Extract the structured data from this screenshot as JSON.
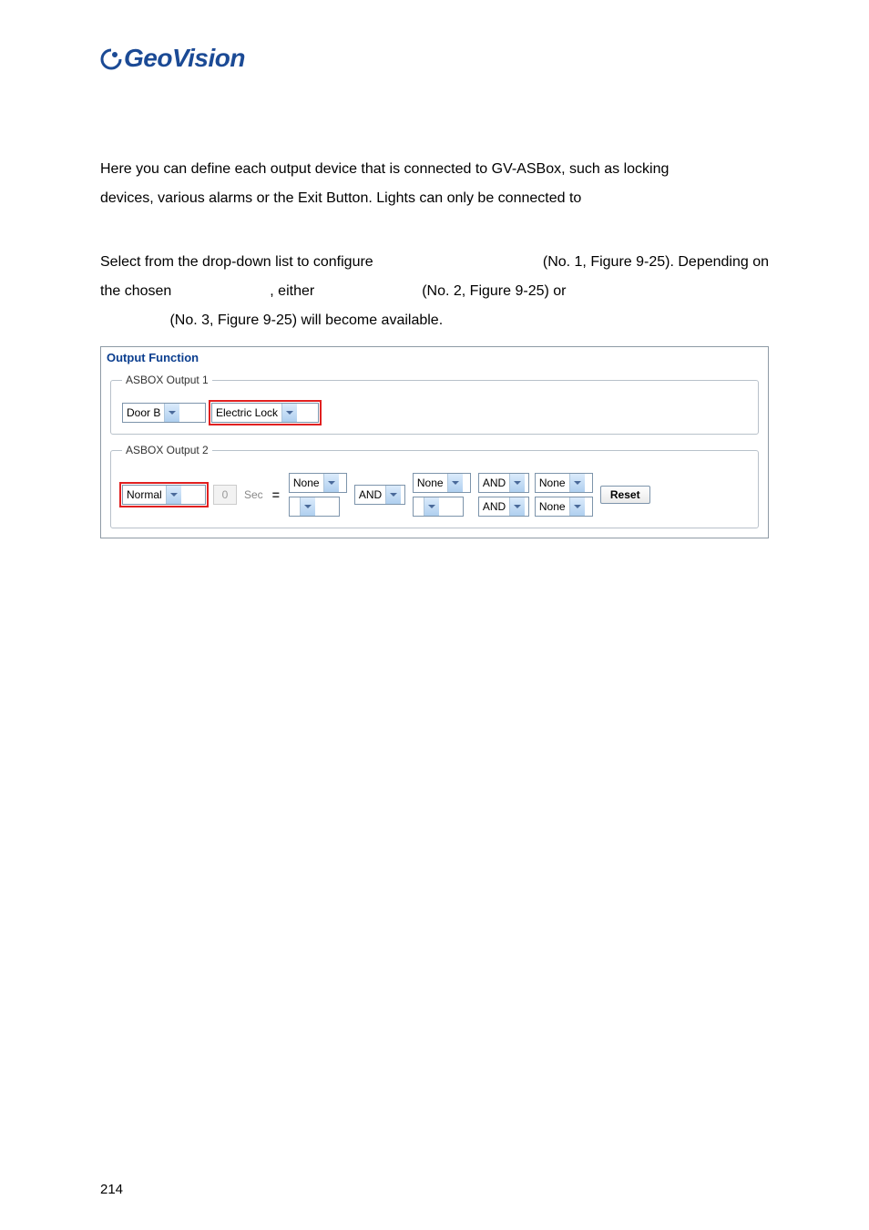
{
  "brand": "GeoVision",
  "paragraph1_a": "Here you can define each output device that is connected to GV-ASBox, such as locking",
  "paragraph1_b": "devices, various alarms or the Exit Button. Lights can only be connected to",
  "para2_seg1": "Select from the drop-down list to configure",
  "para2_ref1": "(No. 1, Figure 9-25). Depending on",
  "para2_seg2a": "the chosen",
  "para2_seg2b": ", either",
  "para2_ref2": "(No. 2, Figure 9-25) or",
  "para2_ref3": "(No. 3, Figure 9-25) will become available.",
  "panel": {
    "title": "Output Function",
    "out1": {
      "legend": "ASBOX Output 1",
      "select_a": "Door B",
      "select_b": "Electric Lock"
    },
    "out2": {
      "legend": "ASBOX Output 2",
      "select_mode": "Normal",
      "num": "0",
      "sec": "Sec",
      "eq": "=",
      "top_none": "None",
      "mid_and": "AND",
      "mid_none": "None",
      "r1_and": "AND",
      "r1_none": "None",
      "r2_and": "AND",
      "r2_none": "None",
      "reset": "Reset"
    }
  },
  "page_number": "214"
}
